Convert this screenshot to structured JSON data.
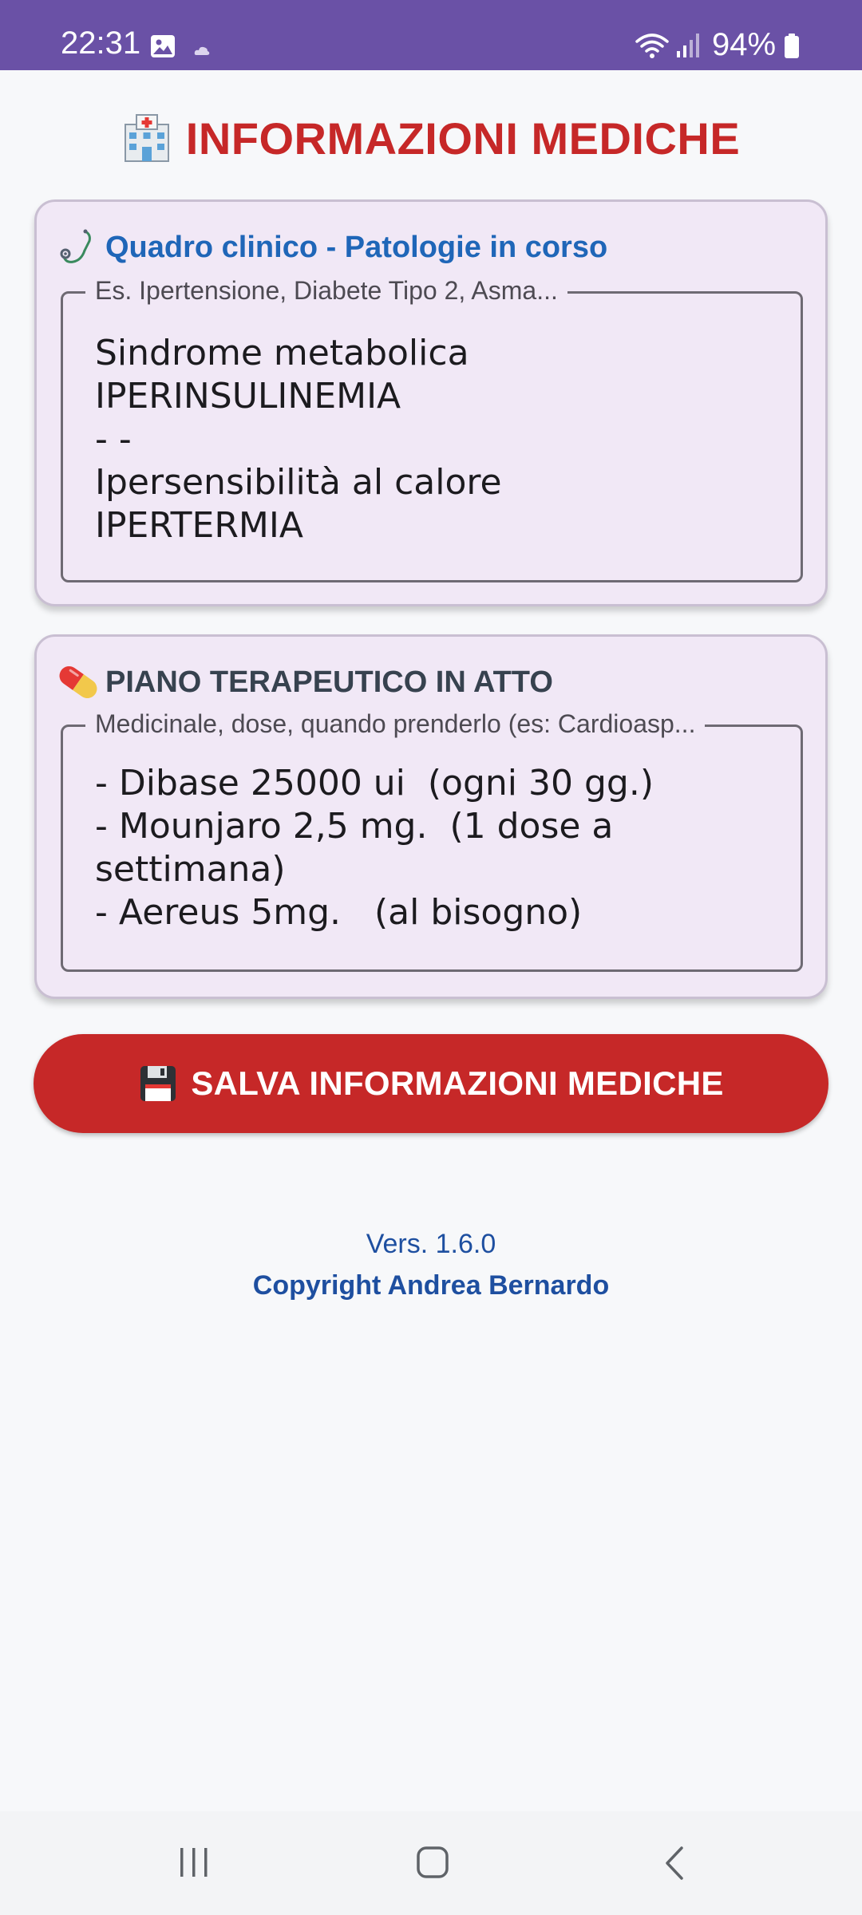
{
  "status_bar": {
    "time": "22:31",
    "battery": "94%",
    "background": "#6a51a6",
    "icons": [
      "gallery-icon",
      "cloud-icon",
      "wifi-icon",
      "signal-icon",
      "battery-icon"
    ]
  },
  "header": {
    "title": "INFORMAZIONI MEDICHE",
    "icon": "hospital-icon",
    "color": "#c62828"
  },
  "clinical": {
    "icon": "stethoscope-icon",
    "title": "Quadro clinico - Patologie in corso",
    "field_label": "Es. Ipertensione, Diabete Tipo 2, Asma...",
    "value": "Sindrome metabolica\nIPERINSULINEMIA\n- -\nIpersensibilità al calore\nIPERTERMIA"
  },
  "therapy": {
    "icon": "pill-icon",
    "title": "PIANO TERAPEUTICO IN ATTO",
    "field_label": "Medicinale, dose, quando prenderlo (es: Cardioasp...",
    "value": "- Dibase 25000 ui  (ogni 30 gg.)\n- Mounjaro 2,5 mg.  (1 dose a settimana)\n- Aereus 5mg.   (al bisogno)"
  },
  "save_button": {
    "icon": "floppy-disk-icon",
    "label": "SALVA INFORMAZIONI MEDICHE",
    "color": "#c62828"
  },
  "footer": {
    "version": "Vers. 1.6.0",
    "copyright": "Copyright Andrea Bernardo"
  },
  "nav_bar": {
    "icons": [
      "recent-apps-icon",
      "home-icon",
      "back-icon"
    ]
  }
}
